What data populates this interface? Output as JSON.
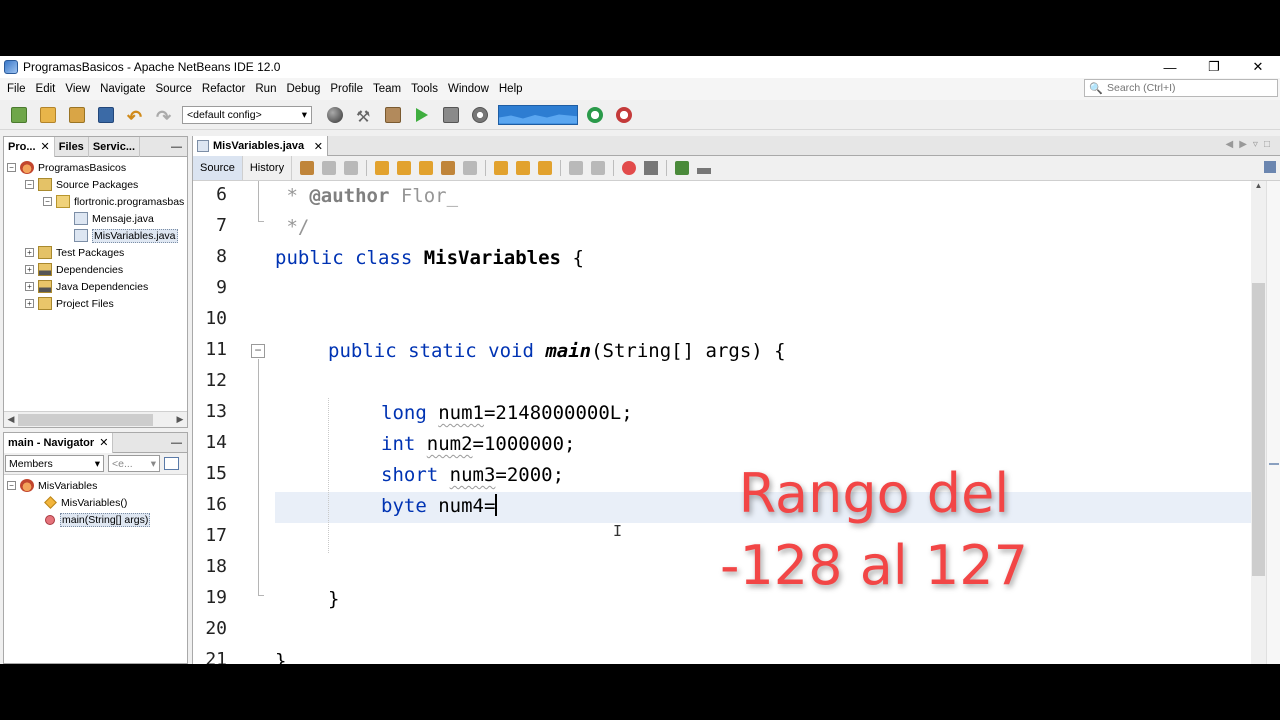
{
  "window": {
    "title": "ProgramasBasicos - Apache NetBeans IDE 12.0",
    "controls": [
      "—",
      "❐",
      "✕"
    ]
  },
  "menu": [
    "File",
    "Edit",
    "View",
    "Navigate",
    "Source",
    "Refactor",
    "Run",
    "Debug",
    "Profile",
    "Team",
    "Tools",
    "Window",
    "Help"
  ],
  "search": {
    "placeholder": "Search (Ctrl+I)"
  },
  "toolbar": {
    "config": "<default config>"
  },
  "projects_panel": {
    "tabs": [
      {
        "label": "Pro...",
        "close": "✕"
      },
      {
        "label": "Files"
      },
      {
        "label": "Servic..."
      }
    ],
    "minimize": "—",
    "tree": [
      {
        "label": "ProgramasBasicos",
        "toggle": "−"
      },
      {
        "label": "Source Packages",
        "toggle": "−"
      },
      {
        "label": "flortronic.programasbas",
        "toggle": "−"
      },
      {
        "label": "Mensaje.java"
      },
      {
        "label": "MisVariables.java"
      },
      {
        "label": "Test Packages",
        "toggle": "+"
      },
      {
        "label": "Dependencies",
        "toggle": "+"
      },
      {
        "label": "Java Dependencies",
        "toggle": "+"
      },
      {
        "label": "Project Files",
        "toggle": "+"
      }
    ]
  },
  "navigator": {
    "title": "main - Navigator",
    "close": "✕",
    "minimize": "—",
    "filter": "Members",
    "filter2": "<e...",
    "tree": [
      {
        "label": "MisVariables",
        "toggle": "−"
      },
      {
        "label": "MisVariables()"
      },
      {
        "label": "main(String[] args)"
      }
    ]
  },
  "editor": {
    "tab": "MisVariables.java",
    "tab_close": "✕",
    "view_tabs": [
      "Source",
      "History"
    ],
    "line_numbers": [
      "6",
      "7",
      "8",
      "9",
      "10",
      "11",
      "12",
      "13",
      "14",
      "15",
      "16",
      "17",
      "18",
      "19",
      "20",
      "21"
    ],
    "code": {
      "l6_star": " * ",
      "l6_tag": "@author",
      "l6_rest": " Flor_",
      "l7": " */",
      "l8_kw": "public class ",
      "l8_cls": "MisVariables",
      "l8_rest": " {",
      "l11_kw": "public static void ",
      "l11_mth": "main",
      "l11_rest": "(String[] args) {",
      "l13_kw": "long ",
      "l13_id": "num1",
      "l13_rest": "=2148000000L;",
      "l14_kw": "int ",
      "l14_id": "num2",
      "l14_rest": "=1000000;",
      "l15_kw": "short ",
      "l15_id": "num3",
      "l15_rest": "=2000;",
      "l16_kw": "byte ",
      "l16_id": "num4",
      "l16_rest": "=",
      "l19": "}",
      "l21": "}"
    }
  },
  "overlay": {
    "line1": "Rango del",
    "line2": "-128 al 127",
    "color": "#f24646"
  }
}
